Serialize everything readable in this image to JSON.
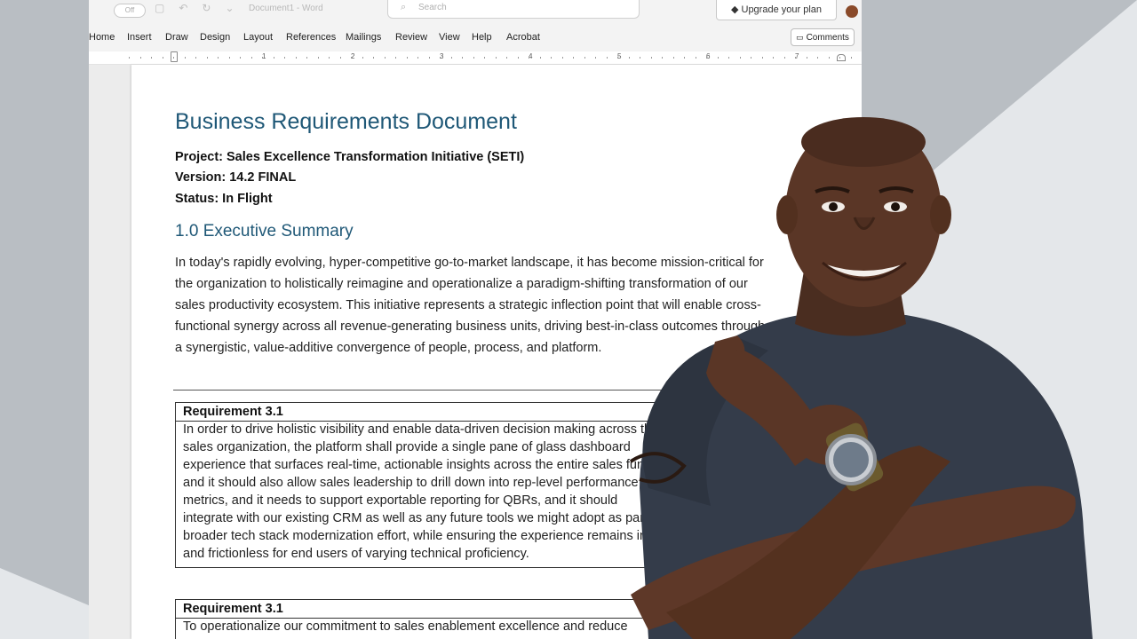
{
  "window": {
    "doc_title": "Document1 - Word",
    "toggle_label": "Off",
    "search_placeholder": "Search",
    "upgrade_label": "Upgrade your plan"
  },
  "menu": {
    "items": [
      "Home",
      "Insert",
      "Draw",
      "Design",
      "Layout",
      "References",
      "Mailings",
      "Review",
      "View",
      "Help",
      "Acrobat"
    ],
    "comments_label": "Comments"
  },
  "ruler": {
    "numbers": [
      "1",
      "2",
      "3",
      "4",
      "5",
      "6",
      "7"
    ]
  },
  "document": {
    "title": "Business Requirements Document",
    "project": "Project: Sales Excellence Transformation Initiative (SETI)",
    "version": "Version: 14.2 FINAL",
    "status": "Status: In Flight",
    "section_heading": "1.0 Executive Summary",
    "summary_lines": [
      "In today's rapidly evolving, hyper-competitive go-to-market landscape, it has become mission-critical for",
      "the organization to holistically reimagine and operationalize a paradigm-shifting transformation of our",
      "sales productivity ecosystem. This initiative represents a strategic inflection point that will enable cross-",
      "functional synergy across all revenue-generating business units, driving best-in-class outcomes through",
      "a synergistic, value-additive convergence of people, process, and platform."
    ],
    "requirements": [
      {
        "heading": "Requirement 3.1",
        "lines": [
          "In order to drive holistic visibility and enable data-driven decision making across the",
          "sales organization, the platform shall provide a single pane of glass dashboard",
          "experience that surfaces real-time, actionable insights across the entire sales funnel,",
          "and it should also allow sales leadership to drill down into rep-level performance",
          "metrics, and it needs to support exportable reporting for QBRs, and it should",
          "integrate with our existing CRM as well as any future tools we might adopt as part of a",
          "broader tech stack modernization effort, while ensuring the experience remains intuitive",
          "and frictionless for end users of varying technical proficiency."
        ]
      },
      {
        "heading": "Requirement 3.1",
        "lines": [
          "To operationalize our commitment to sales enablement excellence and reduce"
        ]
      }
    ]
  }
}
